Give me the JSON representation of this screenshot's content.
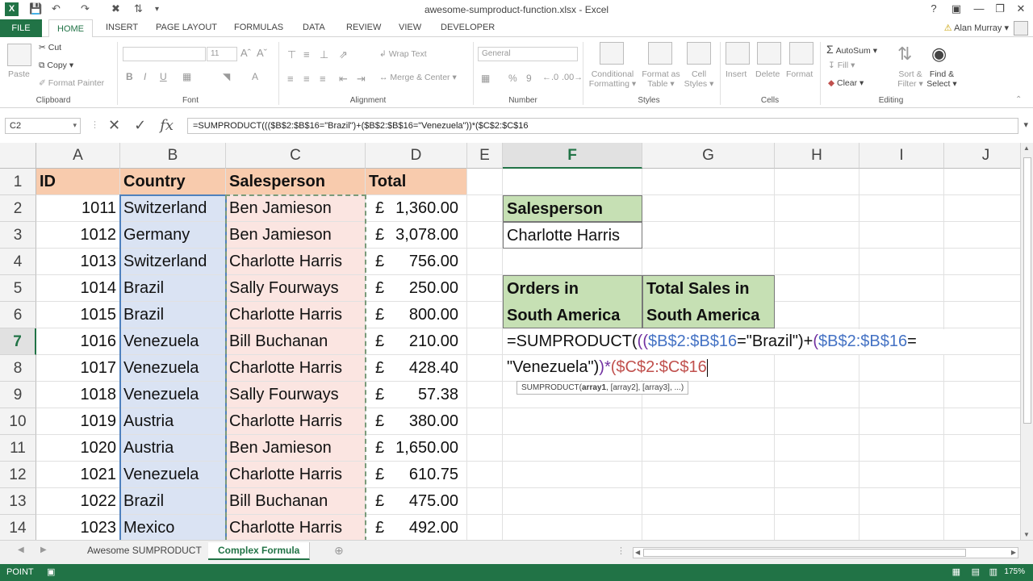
{
  "window": {
    "title": "awesome-sumproduct-function.xlsx - Excel",
    "user": "Alan Murray",
    "help": "?"
  },
  "tabs": [
    "FILE",
    "HOME",
    "INSERT",
    "PAGE LAYOUT",
    "FORMULAS",
    "DATA",
    "REVIEW",
    "VIEW",
    "DEVELOPER"
  ],
  "ribbon": {
    "clipboard": {
      "paste": "Paste",
      "cut": "Cut",
      "copy": "Copy",
      "format_painter": "Format Painter",
      "label": "Clipboard"
    },
    "font": {
      "size": "11",
      "label": "Font",
      "bold": "B",
      "italic": "I",
      "underline": "U"
    },
    "alignment": {
      "wrap_text": "Wrap Text",
      "merge_center": "Merge & Center",
      "label": "Alignment"
    },
    "number": {
      "format": "General",
      "percent": "%",
      "comma": "9",
      "label": "Number"
    },
    "styles": {
      "conditional": "Conditional",
      "conditional2": "Formatting",
      "format_as": "Format as",
      "format_as2": "Table",
      "cell": "Cell",
      "cell2": "Styles",
      "label": "Styles"
    },
    "cells": {
      "insert": "Insert",
      "delete": "Delete",
      "format": "Format",
      "label": "Cells"
    },
    "editing": {
      "autosum": "AutoSum",
      "fill": "Fill",
      "clear": "Clear",
      "sort": "Sort &",
      "sort2": "Filter",
      "find": "Find &",
      "find2": "Select",
      "label": "Editing"
    }
  },
  "formula_bar": {
    "name_box": "C2",
    "formula": "=SUMPRODUCT((($B$2:$B$16=\"Brazil\")+($B$2:$B$16=\"Venezuela\"))*($C$2:$C$16"
  },
  "columns": [
    "A",
    "B",
    "C",
    "D",
    "E",
    "F",
    "G",
    "H",
    "I",
    "J"
  ],
  "rows": [
    "1",
    "2",
    "3",
    "4",
    "5",
    "6",
    "7",
    "8",
    "9",
    "10",
    "11",
    "12",
    "13",
    "14"
  ],
  "table": {
    "headers": [
      "ID",
      "Country",
      "Salesperson",
      "Total"
    ],
    "currency": "£",
    "rows": [
      {
        "id": "1011",
        "country": "Switzerland",
        "sales": "Ben Jamieson",
        "total": "1,360.00"
      },
      {
        "id": "1012",
        "country": "Germany",
        "sales": "Ben Jamieson",
        "total": "3,078.00"
      },
      {
        "id": "1013",
        "country": "Switzerland",
        "sales": "Charlotte Harris",
        "total": "756.00"
      },
      {
        "id": "1014",
        "country": "Brazil",
        "sales": "Sally Fourways",
        "total": "250.00"
      },
      {
        "id": "1015",
        "country": "Brazil",
        "sales": "Charlotte Harris",
        "total": "800.00"
      },
      {
        "id": "1016",
        "country": "Venezuela",
        "sales": "Bill Buchanan",
        "total": "210.00"
      },
      {
        "id": "1017",
        "country": "Venezuela",
        "sales": "Charlotte Harris",
        "total": "428.40"
      },
      {
        "id": "1018",
        "country": "Venezuela",
        "sales": "Sally Fourways",
        "total": "57.38"
      },
      {
        "id": "1019",
        "country": "Austria",
        "sales": "Charlotte Harris",
        "total": "380.00"
      },
      {
        "id": "1020",
        "country": "Austria",
        "sales": "Ben Jamieson",
        "total": "1,650.00"
      },
      {
        "id": "1021",
        "country": "Venezuela",
        "sales": "Charlotte Harris",
        "total": "610.75"
      },
      {
        "id": "1022",
        "country": "Brazil",
        "sales": "Bill Buchanan",
        "total": "475.00"
      },
      {
        "id": "1023",
        "country": "Mexico",
        "sales": "Charlotte Harris",
        "total": "492.00"
      }
    ]
  },
  "side": {
    "salesperson_label": "Salesperson",
    "salesperson_value": "Charlotte Harris",
    "orders_label_1": "Orders in",
    "orders_label_2": "South America",
    "total_label_1": "Total Sales in",
    "total_label_2": "South America"
  },
  "editing_formula": {
    "p1": "=SUMPRODUCT(",
    "p2": "((",
    "ref1": "$B$2:$B$16",
    "p3": "=\"Brazil\")+",
    "p4": "(",
    "ref2": "$B$2:$B$16",
    "p5": "=",
    "line2_a": "\"Venezuela\")",
    "line2_b": ")*",
    "line2_c": "(",
    "ref3": "$C$2:$C$16"
  },
  "tooltip": {
    "fn": "SUMPRODUCT(",
    "arg1": "array1",
    "rest": ", [array2], [array3], ...)"
  },
  "sheets": [
    "Awesome SUMPRODUCT",
    "Complex Formula"
  ],
  "active_sheet": "Complex Formula",
  "status": {
    "mode": "POINT",
    "zoom": "175%"
  },
  "colors": {
    "excel_green": "#217346",
    "header_fill": "#f8cbad",
    "country_fill": "#dae3f3",
    "sales_fill": "#fbe5e1",
    "label_fill": "#c6e0b4"
  }
}
